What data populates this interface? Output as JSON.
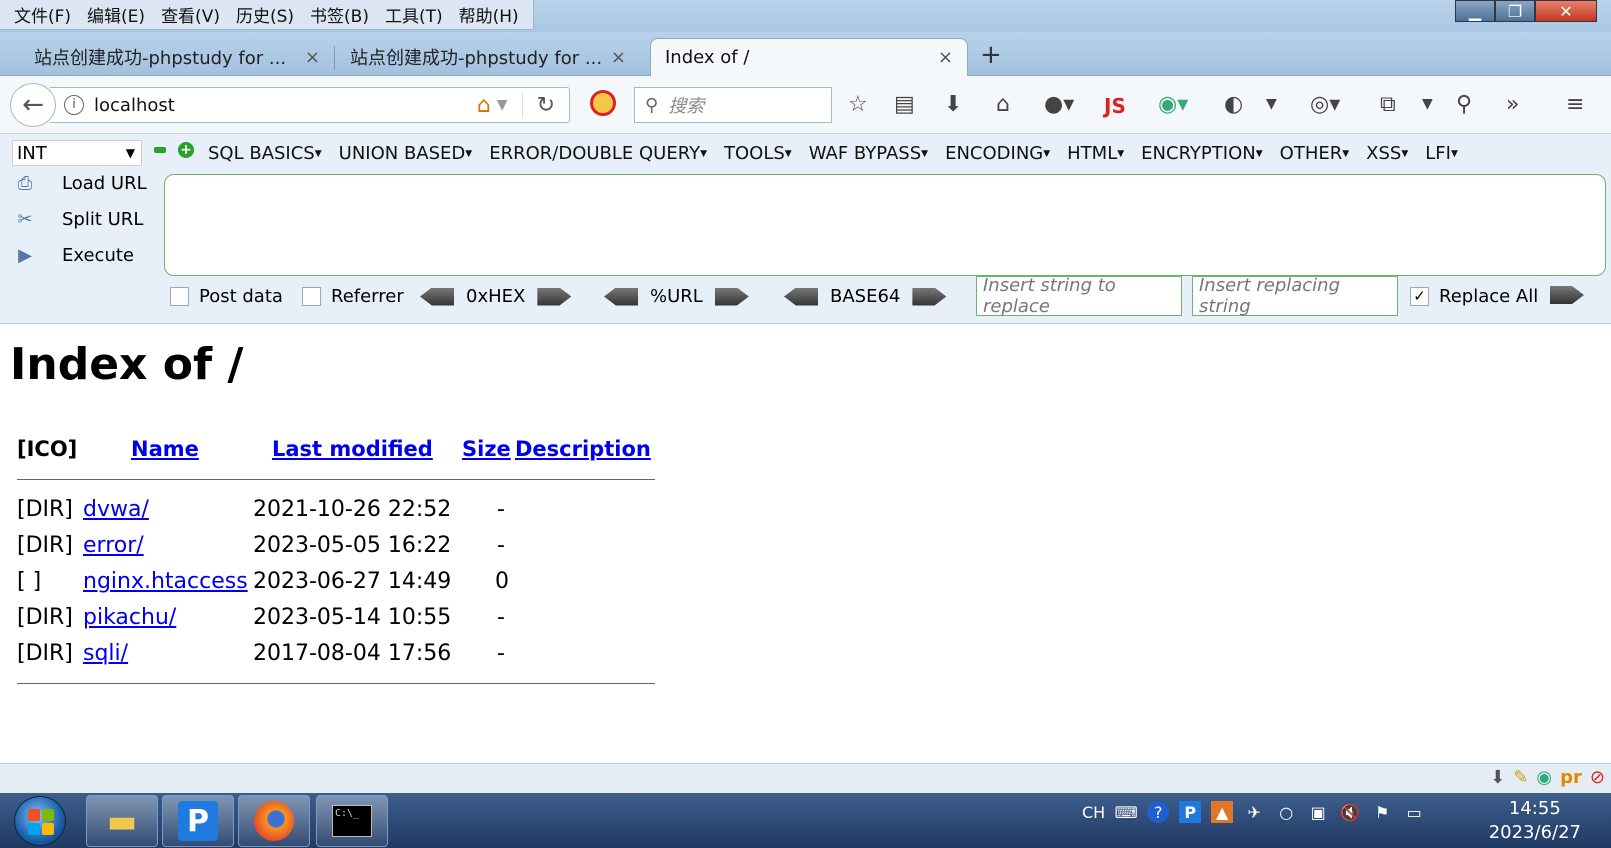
{
  "menubar": [
    "文件(F)",
    "编辑(E)",
    "查看(V)",
    "历史(S)",
    "书签(B)",
    "工具(T)",
    "帮助(H)"
  ],
  "window_controls": {
    "minimize": "▁",
    "restore": "❐",
    "close": "✕"
  },
  "tabs": [
    {
      "title": "站点创建成功-phpstudy for ...",
      "close": "×"
    },
    {
      "title": "站点创建成功-phpstudy for ...",
      "close": "×"
    },
    {
      "title": "Index of /",
      "close": "×",
      "active": true
    }
  ],
  "new_tab": "+",
  "navbar": {
    "url": "localhost",
    "search_placeholder": "搜索",
    "js_label": "JS"
  },
  "hackbar": {
    "select_value": "INT",
    "menus": [
      "SQL BASICS",
      "UNION BASED",
      "ERROR/DOUBLE QUERY",
      "TOOLS",
      "WAF BYPASS",
      "ENCODING",
      "HTML",
      "ENCRYPTION",
      "OTHER",
      "XSS",
      "LFI"
    ],
    "actions": [
      "Load URL",
      "Split URL",
      "Execute"
    ],
    "post_data": "Post data",
    "referrer": "Referrer",
    "hex": "0xHEX",
    "url_enc": "%URL",
    "base64": "BASE64",
    "replace_placeholder": "Insert string to replace",
    "replacing_placeholder": "Insert replacing string",
    "replace_all": "Replace All",
    "replace_all_checked": true
  },
  "page": {
    "title": "Index of /",
    "columns": {
      "ico": "[ICO]",
      "name": "Name",
      "modified": "Last modified",
      "size": "Size",
      "description": "Description"
    },
    "rows": [
      {
        "icon": "[DIR]",
        "name": "dvwa/",
        "modified": "2021-10-26 22:52",
        "size": "-"
      },
      {
        "icon": "[DIR]",
        "name": "error/",
        "modified": "2023-05-05 16:22",
        "size": "-"
      },
      {
        "icon": "[ ]",
        "name": "nginx.htaccess",
        "modified": "2023-06-27 14:49",
        "size": "0"
      },
      {
        "icon": "[DIR]",
        "name": "pikachu/",
        "modified": "2023-05-14 10:55",
        "size": "-"
      },
      {
        "icon": "[DIR]",
        "name": "sqli/",
        "modified": "2017-08-04 17:56",
        "size": "-"
      }
    ]
  },
  "taskbar": {
    "lang": "CH",
    "time": "14:55",
    "date": "2023/6/27"
  },
  "colors": {
    "link": "#0000ee",
    "taskbar": "#203a63",
    "hackbar_bg": "#e7f0f8",
    "hackbar_border": "#6db36d"
  }
}
